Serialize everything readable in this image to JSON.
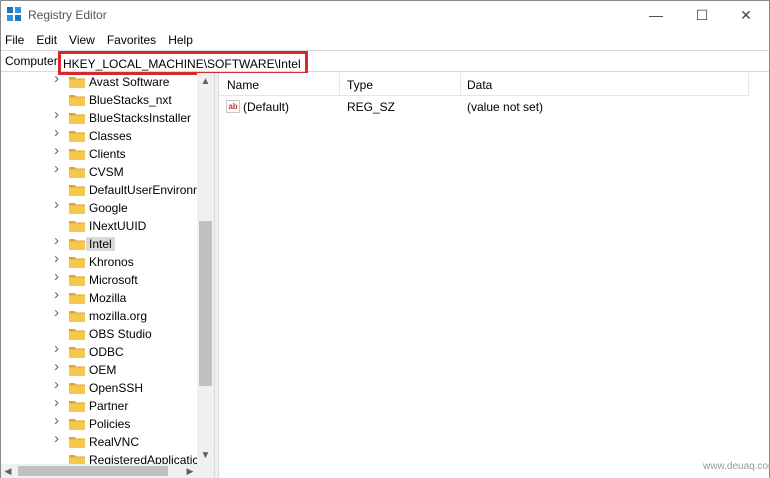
{
  "window": {
    "title": "Registry Editor"
  },
  "title_buttons": {
    "minimize": "—",
    "maximize": "☐",
    "close": "✕"
  },
  "menu": [
    "File",
    "Edit",
    "View",
    "Favorites",
    "Help"
  ],
  "address": {
    "prefix": "Computer\\",
    "path": "HKEY_LOCAL_MACHINE\\SOFTWARE\\Intel",
    "highlight_color": "#d42a2a"
  },
  "tree": {
    "selected": "Intel",
    "items": [
      {
        "label": "Avast Software",
        "expandable": true
      },
      {
        "label": "BlueStacks_nxt",
        "expandable": false
      },
      {
        "label": "BlueStacksInstaller",
        "expandable": true
      },
      {
        "label": "Classes",
        "expandable": true
      },
      {
        "label": "Clients",
        "expandable": true
      },
      {
        "label": "CVSM",
        "expandable": true
      },
      {
        "label": "DefaultUserEnvironn",
        "expandable": false
      },
      {
        "label": "Google",
        "expandable": true
      },
      {
        "label": "INextUUID",
        "expandable": false
      },
      {
        "label": "Intel",
        "expandable": true
      },
      {
        "label": "Khronos",
        "expandable": true
      },
      {
        "label": "Microsoft",
        "expandable": true
      },
      {
        "label": "Mozilla",
        "expandable": true
      },
      {
        "label": "mozilla.org",
        "expandable": true
      },
      {
        "label": "OBS Studio",
        "expandable": false
      },
      {
        "label": "ODBC",
        "expandable": true
      },
      {
        "label": "OEM",
        "expandable": true
      },
      {
        "label": "OpenSSH",
        "expandable": true
      },
      {
        "label": "Partner",
        "expandable": true
      },
      {
        "label": "Policies",
        "expandable": true
      },
      {
        "label": "RealVNC",
        "expandable": true
      },
      {
        "label": "RegisteredApplicatic",
        "expandable": false
      }
    ]
  },
  "list": {
    "columns": [
      "Name",
      "Type",
      "Data"
    ],
    "rows": [
      {
        "icon": "reg-string-icon",
        "icon_text": "ab",
        "name": "(Default)",
        "type": "REG_SZ",
        "data": "(value not set)"
      }
    ]
  },
  "watermark": "www.deuaq.com",
  "colors": {
    "folder": "#f5c84c",
    "folder_dark": "#dba632",
    "selected_bg": "#d9d9d9"
  }
}
